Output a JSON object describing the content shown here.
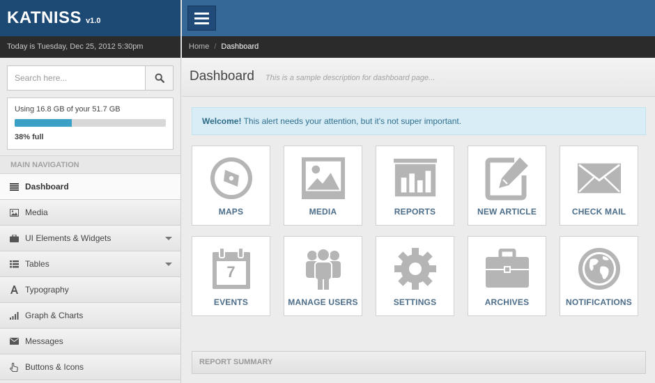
{
  "brand": {
    "name": "KATNISS",
    "version": "v1.0"
  },
  "date_text": "Today is Tuesday, Dec 25, 2012 5:30pm",
  "search": {
    "placeholder": "Search here..."
  },
  "storage": {
    "text": "Using 16.8 GB of your 51.7 GB",
    "percent_label": "38% full",
    "fraction": 0.38
  },
  "nav": {
    "header": "MAIN NAVIGATION",
    "items": [
      {
        "label": "Dashboard",
        "icon": "list-icon",
        "active": true
      },
      {
        "label": "Media",
        "icon": "image-icon"
      },
      {
        "label": "UI Elements & Widgets",
        "icon": "briefcase-icon",
        "has_submenu": true
      },
      {
        "label": "Tables",
        "icon": "table-icon",
        "has_submenu": true
      },
      {
        "label": "Typography",
        "icon": "font-icon"
      },
      {
        "label": "Graph & Charts",
        "icon": "signal-icon"
      },
      {
        "label": "Messages",
        "icon": "envelope-icon"
      },
      {
        "label": "Buttons & Icons",
        "icon": "hand-pointer-icon"
      }
    ]
  },
  "breadcrumb": {
    "home": "Home",
    "separator": "/",
    "current": "Dashboard"
  },
  "page": {
    "title": "Dashboard",
    "description": "This is a sample description for dashboard page..."
  },
  "alert": {
    "strong": "Welcome!",
    "text": " This alert needs your attention, but it's not super important."
  },
  "tiles": [
    {
      "label": "MAPS",
      "icon": "compass-icon"
    },
    {
      "label": "MEDIA",
      "icon": "picture-icon"
    },
    {
      "label": "REPORTS",
      "icon": "bar-chart-icon"
    },
    {
      "label": "NEW ARTICLE",
      "icon": "edit-icon"
    },
    {
      "label": "CHECK MAIL",
      "icon": "envelope-icon"
    },
    {
      "label": "EVENTS",
      "icon": "calendar-icon",
      "calendar_day": "7"
    },
    {
      "label": "MANAGE USERS",
      "icon": "users-icon"
    },
    {
      "label": "SETTINGS",
      "icon": "gear-icon"
    },
    {
      "label": "ARCHIVES",
      "icon": "briefcase-icon"
    },
    {
      "label": "NOTIFICATIONS",
      "icon": "globe-icon"
    }
  ],
  "report_summary": "REPORT SUMMARY",
  "colors": {
    "brand_bg": "#1d4a75",
    "topbar_bg": "#356797",
    "dark_bar": "#2b2b2b",
    "alert_bg": "#d9edf7",
    "progress": "#3aa0c5",
    "icon_gray": "#b5b5b5",
    "tile_label": "#4c6d8a"
  }
}
